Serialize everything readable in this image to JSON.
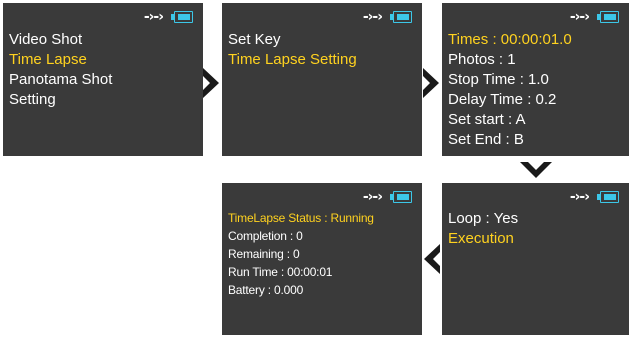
{
  "colors": {
    "screen_bg": "#3a3a3a",
    "text": "#ffffff",
    "highlight": "#ffd21f",
    "battery": "#3cc7e8",
    "arrow": "#1a1a1a"
  },
  "status_bar": {
    "arrows_text": "-›-›",
    "battery_icon": "battery-icon"
  },
  "screens": {
    "main_menu": {
      "items": [
        "Video Shot",
        "Time Lapse",
        "Panotama Shot",
        "Setting"
      ],
      "selected_index": 1
    },
    "time_lapse_menu": {
      "items": [
        "Set Key",
        "Time Lapse Setting"
      ],
      "selected_index": 1
    },
    "time_lapse_setting": {
      "items": [
        "Times : 00:00:01.0",
        "Photos : 1",
        "Stop Time : 1.0",
        "Delay Time : 0.2",
        "Set start : A",
        "Set End : B"
      ],
      "selected_index": 0
    },
    "execution_menu": {
      "items": [
        "Loop : Yes",
        "Execution"
      ],
      "selected_index": 1
    },
    "status_screen": {
      "items": [
        "TimeLapse Status : Running",
        "Completion : 0",
        "Remaining : 0",
        "Run Time : 00:00:01",
        "Battery : 0.000"
      ],
      "selected_index": 0
    }
  },
  "flow_arrows": [
    "arrow-right-icon",
    "arrow-right-icon",
    "arrow-down-icon",
    "arrow-left-icon"
  ]
}
